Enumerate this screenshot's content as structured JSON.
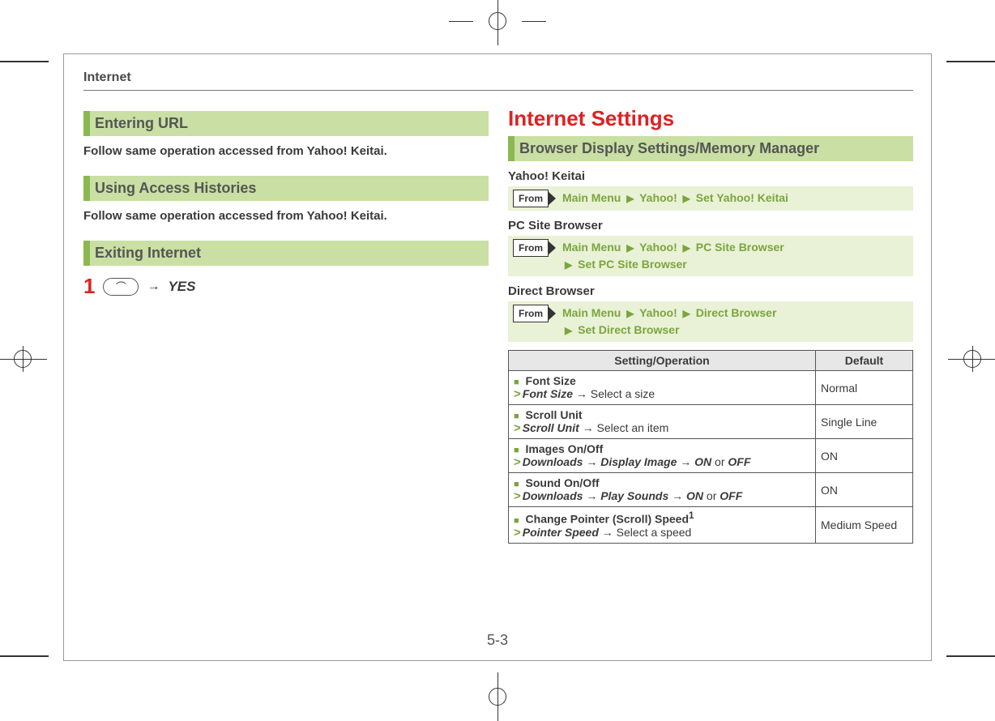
{
  "chapter": "Internet",
  "left": {
    "sections": [
      {
        "title": "Entering URL",
        "body": "Follow same operation accessed from Yahoo! Keitai."
      },
      {
        "title": "Using Access Histories",
        "body": "Follow same operation accessed from Yahoo! Keitai."
      },
      {
        "title": "Exiting Internet"
      }
    ],
    "step": {
      "num": "1",
      "key_glyph": "⌒",
      "arrow": "→",
      "yes": "YES"
    }
  },
  "right": {
    "heading": "Internet Settings",
    "section_title": "Browser Display Settings/Memory Manager",
    "from_label": "From",
    "tri": "▶",
    "blocks": [
      {
        "label": "Yahoo! Keitai",
        "crumbs": [
          "Main Menu",
          "Yahoo!",
          "Set Yahoo! Keitai"
        ]
      },
      {
        "label": "PC Site Browser",
        "crumbs": [
          "Main Menu",
          "Yahoo!",
          "PC Site Browser",
          "Set PC Site Browser"
        ],
        "break_after": 3
      },
      {
        "label": "Direct Browser",
        "crumbs": [
          "Main Menu",
          "Yahoo!",
          "Direct Browser",
          "Set Direct Browser"
        ],
        "break_after": 3
      }
    ],
    "table": {
      "headers": [
        "Setting/Operation",
        "Default"
      ],
      "rows": [
        {
          "title": "Font Size",
          "op_prefix": "Font Size",
          "op_arrow": "→",
          "op_tail": "Select a size",
          "default": "Normal"
        },
        {
          "title": "Scroll Unit",
          "op_prefix": "Scroll Unit",
          "op_arrow": "→",
          "op_tail": "Select an item",
          "default": "Single Line"
        },
        {
          "title": "Images On/Off",
          "op_html_parts": [
            "Downloads",
            "→",
            "Display Image",
            "→",
            "ON",
            " or ",
            "OFF"
          ],
          "default": "ON"
        },
        {
          "title": "Sound On/Off",
          "op_html_parts": [
            "Downloads",
            "→",
            "Play Sounds",
            "→",
            "ON",
            " or ",
            "OFF"
          ],
          "default": "ON"
        },
        {
          "title": "Change Pointer (Scroll) Speed",
          "title_sup": "1",
          "op_prefix": "Pointer Speed",
          "op_arrow": "→",
          "op_tail": "Select a speed",
          "default": "Medium Speed"
        }
      ]
    }
  },
  "page_num": "5-3"
}
